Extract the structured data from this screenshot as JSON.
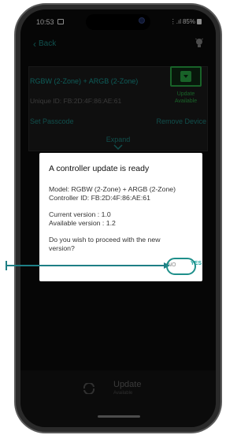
{
  "status_bar": {
    "time": "10:53",
    "signal_text": "☷📶",
    "battery_text": "85%"
  },
  "header": {
    "back_label": "Back"
  },
  "device": {
    "name": "RGBW (2-Zone) + ARGB (2-Zone)",
    "unique_id": "Unique ID: FB:2D:4F:86:AE:61",
    "update_label_line1": "Update",
    "update_label_line2": "Available",
    "set_passcode": "Set Passcode",
    "remove_device": "Remove Device",
    "expand": "Expand"
  },
  "bottom_bar": {
    "update_label": "Update",
    "update_sub": "Available"
  },
  "dialog": {
    "title": "A controller update is ready",
    "model": "Model: RGBW (2-Zone) + ARGB (2-Zone)",
    "controller_id": "Controller ID: FB:2D:4F:86:AE:61",
    "current_version": "Current version   : 1.0",
    "available_version": "Available version : 1.2",
    "question_line1": "Do you wish to proceed with the new",
    "question_line2": "version?",
    "no_label": "NO",
    "yes_label": "YES"
  },
  "colors": {
    "accent": "#1aa6a0",
    "update_green": "#2db24a",
    "callout": "#1e7f85"
  }
}
